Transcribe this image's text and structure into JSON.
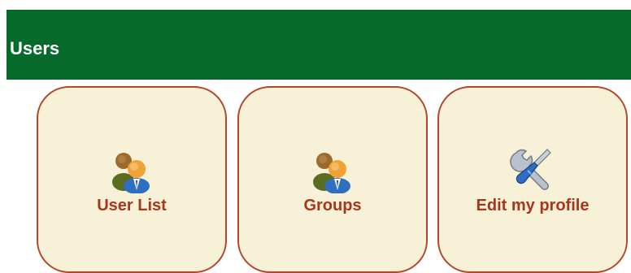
{
  "header": {
    "title": "Users",
    "background": "#066a2a"
  },
  "tiles": [
    {
      "label": "User List",
      "icon": "users-icon"
    },
    {
      "label": "Groups",
      "icon": "users-icon"
    },
    {
      "label": "Edit my profile",
      "icon": "tools-icon"
    }
  ],
  "colors": {
    "tile_background": "#f6f1d7",
    "tile_border": "#b2472a",
    "tile_label": "#a8361c"
  }
}
